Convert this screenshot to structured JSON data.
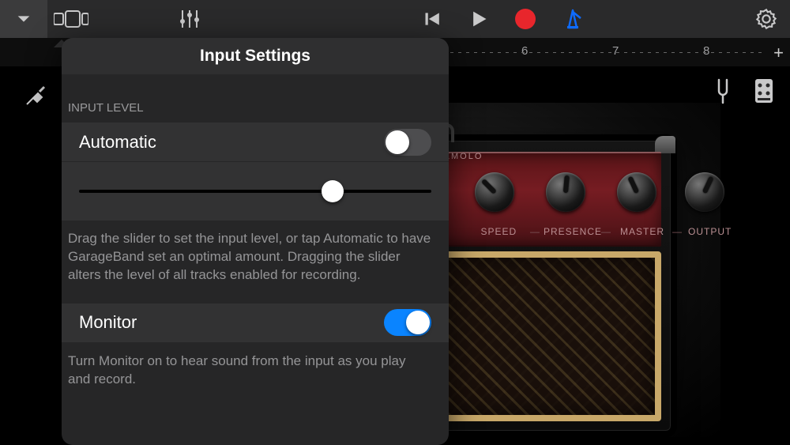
{
  "topbar": {
    "icons": {
      "nav": "nav-drop",
      "tracks": "tracks",
      "mixer": "mixer",
      "rewind": "rewind",
      "play": "play",
      "record": "record",
      "metronome": "metronome",
      "settings": "gear"
    }
  },
  "ruler": {
    "marks": [
      6,
      7,
      8
    ]
  },
  "amp": {
    "badge": "TREMOLO",
    "knobs": [
      {
        "label": "SPEED",
        "deg": -45
      },
      {
        "label": "PRESENCE",
        "deg": 5
      },
      {
        "label": "MASTER",
        "deg": -25
      },
      {
        "label": "OUTPUT",
        "deg": 25
      }
    ],
    "sep": "—"
  },
  "popover": {
    "title": "Input Settings",
    "section_input": "INPUT LEVEL",
    "automatic_label": "Automatic",
    "automatic_on": false,
    "slider_pos": 0.72,
    "input_help": "Drag the slider to set the input level, or tap Automatic to have GarageBand set an optimal amount. Dragging the slider alters the level of all tracks enabled for recording.",
    "monitor_label": "Monitor",
    "monitor_on": true,
    "monitor_help": "Turn Monitor on to hear sound from the input as you play and record."
  }
}
